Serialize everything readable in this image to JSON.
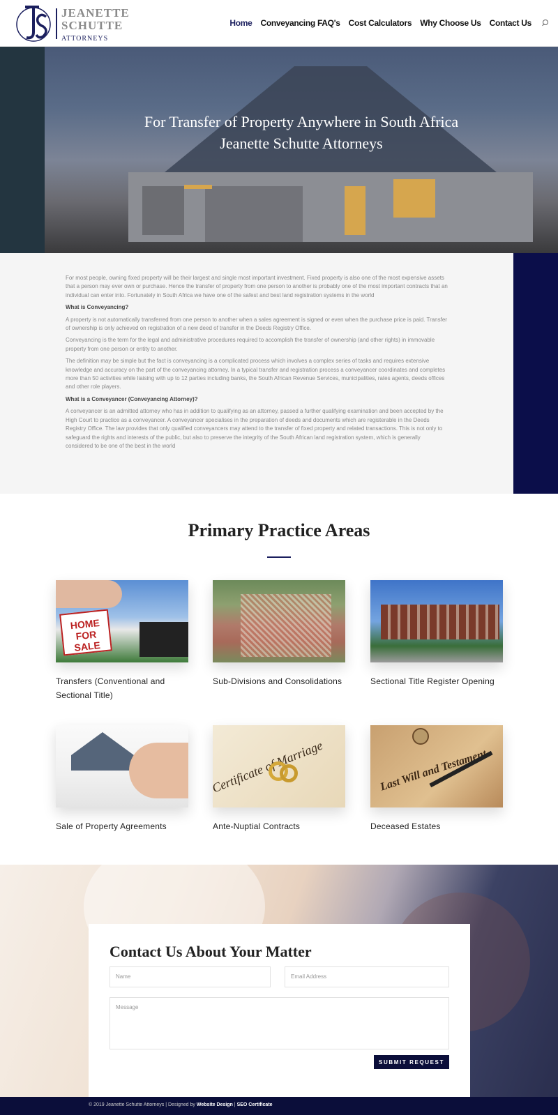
{
  "header": {
    "logo_line1": "JEANETTE",
    "logo_line2": "SCHUTTE",
    "logo_sub": "ATTORNEYS",
    "nav": [
      "Home",
      "Conveyancing FAQ's",
      "Cost Calculators",
      "Why Choose Us",
      "Contact Us"
    ]
  },
  "hero": {
    "line1": "For Transfer of Property Anywhere in South Africa",
    "line2": "Jeanette Schutte Attorneys"
  },
  "intro": {
    "p1": "For most people, owning fixed property will be their largest and single most important investment. Fixed property is also one of the most expensive assets that a person may ever own or purchase. Hence the transfer of property from one person to another is probably one of the most important contracts that an individual can enter into. Fortunately in South Africa we have one of the safest and best land registration systems in the world",
    "h1": "What is Conveyancing?",
    "p2": "A property is not automatically transferred from one person to another when a sales agreement is signed or even when the purchase price is paid. Transfer of ownership is only achieved on registration of a new deed of transfer in the Deeds Registry Office.",
    "p3": "Conveyancing is the term for the legal and administrative procedures required to accomplish the transfer of ownership (and other rights) in immovable property from one person or entity to another.",
    "p4": "The definition may be simple but the fact is conveyancing is a complicated process which involves a complex series of tasks and requires extensive knowledge and accuracy on the part of the conveyancing attorney. In a typical transfer and registration process a conveyancer coordinates and completes more than 50 activities while liaising with up to 12 parties including banks, the South African Revenue Services, municipalities, rates agents, deeds offices and other role players.",
    "h2": "What is a Conveyancer (Conveyancing Attorney)?",
    "p5": "A conveyancer is an admitted attorney who has in addition to qualifying as an attorney, passed a further qualifying examination and been accepted by the High Court to practice as a conveyancer. A conveyancer specialises in the preparation of deeds and documents which are registerable in the Deeds Registry Office. The law provides that only qualified conveyancers may attend to the transfer of fixed property and related transactions. This is not only to safeguard the rights and interests of the public, but also to preserve the integrity of the South African land registration system, which is generally considered to be one of the best in the world"
  },
  "practice": {
    "title": "Primary Practice Areas",
    "cards": [
      {
        "label": "Transfers (Conventional and Sectional Title)",
        "sign": "HOME FOR SALE"
      },
      {
        "label": "Sub-Divisions and Consolidations"
      },
      {
        "label": "Sectional Title Register Opening"
      },
      {
        "label": "Sale of Property Agreements"
      },
      {
        "label": "Ante-Nuptial Contracts",
        "image_text": "Certificate of Marriage"
      },
      {
        "label": "Deceased Estates",
        "image_text": "Last Will and Testament"
      }
    ]
  },
  "contact": {
    "title": "Contact Us About Your Matter",
    "name_placeholder": "Name",
    "email_placeholder": "Email Address",
    "message_placeholder": "Message",
    "submit": "SUBMIT REQUEST"
  },
  "footer": {
    "prefix": "© 2019 Jeanette Schutte Attorneys | Designed by ",
    "link1": "Website Design",
    "sep": " | ",
    "link2": "SEO Certificate"
  },
  "colors": {
    "navy": "#0b0e3a",
    "brand": "#1b1f5e"
  }
}
